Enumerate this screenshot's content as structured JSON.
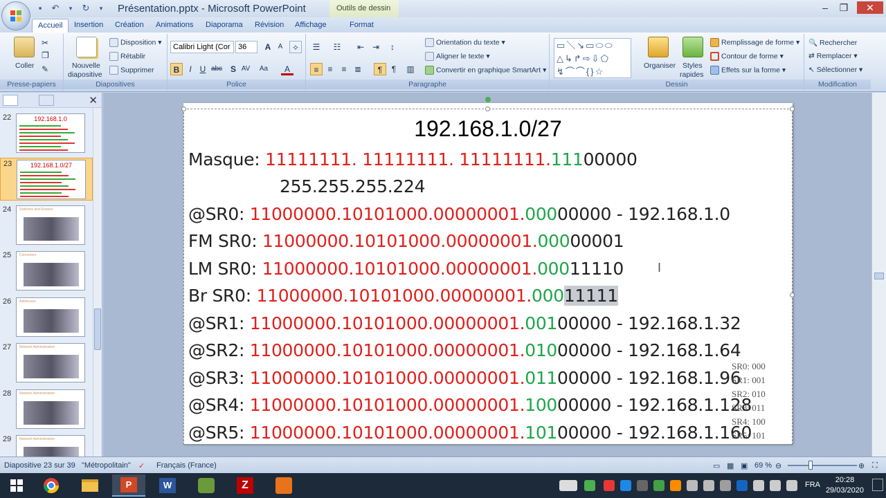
{
  "window": {
    "title": "Présentation.pptx - Microsoft PowerPoint",
    "contextual_tab": "Outils de dessin"
  },
  "tabs": [
    "Accueil",
    "Insertion",
    "Création",
    "Animations",
    "Diaporama",
    "Révision",
    "Affichage",
    "Format"
  ],
  "ribbon": {
    "presse_papiers": {
      "label": "Presse-papiers",
      "coller": "Coller"
    },
    "diapositives": {
      "label": "Diapositives",
      "nouvelle": "Nouvelle",
      "nouvelle2": "diapositive",
      "disposition": "Disposition",
      "retablir": "Rétablir",
      "supprimer": "Supprimer"
    },
    "police": {
      "label": "Police",
      "font_name": "Calibri Light (Cor",
      "font_size": "36"
    },
    "paragraphe": {
      "label": "Paragraphe",
      "orientation": "Orientation du texte",
      "aligner": "Aligner le texte",
      "convertir": "Convertir en graphique SmartArt"
    },
    "dessin": {
      "label": "Dessin",
      "organiser": "Organiser",
      "styles": "Styles",
      "rapides": "rapides",
      "remplissage": "Remplissage de forme",
      "contour": "Contour de forme",
      "effets": "Effets sur la forme"
    },
    "modification": {
      "label": "Modification",
      "rechercher": "Rechercher",
      "remplacer": "Remplacer",
      "selectionner": "Sélectionner"
    }
  },
  "thumbnails": [
    {
      "num": "22",
      "title": "192.168.1.0"
    },
    {
      "num": "23",
      "title": "192.168.1.0/27"
    },
    {
      "num": "24",
      "title": "Switches and Routers"
    },
    {
      "num": "25",
      "title": "Convertors"
    },
    {
      "num": "26",
      "title": "Addresses"
    },
    {
      "num": "27",
      "title": "Network Administration"
    },
    {
      "num": "28",
      "title": "Network Administration"
    },
    {
      "num": "29",
      "title": "Network Administration"
    }
  ],
  "slide": {
    "title": "192.168.1.0/27",
    "masque_label": "Masque:",
    "masque_red": "11111111. 11111111. 11111111.",
    "masque_green": "111",
    "masque_black": "00000",
    "masque_decimal": "255.255.255.224",
    "rows": [
      {
        "label": "@SR0:",
        "red": "11000000.10101000.00000001.",
        "green": "000",
        "black": "00000",
        "suffix": " - 192.168.1.0"
      },
      {
        "label": "FM SR0:",
        "red": "11000000.10101000.00000001.",
        "green": "000",
        "black": "00001",
        "suffix": ""
      },
      {
        "label": "LM SR0:",
        "red": "11000000.10101000.00000001.",
        "green": "000",
        "black": "11110",
        "suffix": ""
      },
      {
        "label": "Br SR0:",
        "red": "11000000.10101000.00000001.",
        "green": "000",
        "black": "11111",
        "suffix": ""
      },
      {
        "label": "@SR1:",
        "red": "11000000.10101000.00000001.",
        "green": "001",
        "black": "00000",
        "suffix": "- 192.168.1.32"
      },
      {
        "label": "@SR2:",
        "red": "11000000.10101000.00000001.",
        "green": "010",
        "black": "00000",
        "suffix": "- 192.168.1.64"
      },
      {
        "label": "@SR3:",
        "red": "11000000.10101000.00000001.",
        "green": "011",
        "black": "00000",
        "suffix": "- 192.168.1.96"
      },
      {
        "label": "@SR4:",
        "red": "11000000.10101000.00000001.",
        "green": "100",
        "black": "00000",
        "suffix": "- 192.168.1.128"
      },
      {
        "label": "@SR5:",
        "red": "11000000.10101000.00000001.",
        "green": "101",
        "black": "00000",
        "suffix": "- 192.168.1.160"
      }
    ],
    "side_notes": [
      "SR0: 000",
      "SR1: 001",
      "SR2: 010",
      "SR3: 011",
      "SR4: 100",
      "SR5: 101"
    ]
  },
  "status": {
    "slide_info": "Diapositive 23 sur 39",
    "theme": "\"Métropolitain\"",
    "language": "Français (France)",
    "zoom": "69 %"
  },
  "taskbar": {
    "lang": "FRA",
    "time": "20:28",
    "date": "29/03/2020"
  },
  "colors": {
    "red": "#e0201c",
    "green": "#1ea64a",
    "ribbon": "#dbe6f4"
  }
}
